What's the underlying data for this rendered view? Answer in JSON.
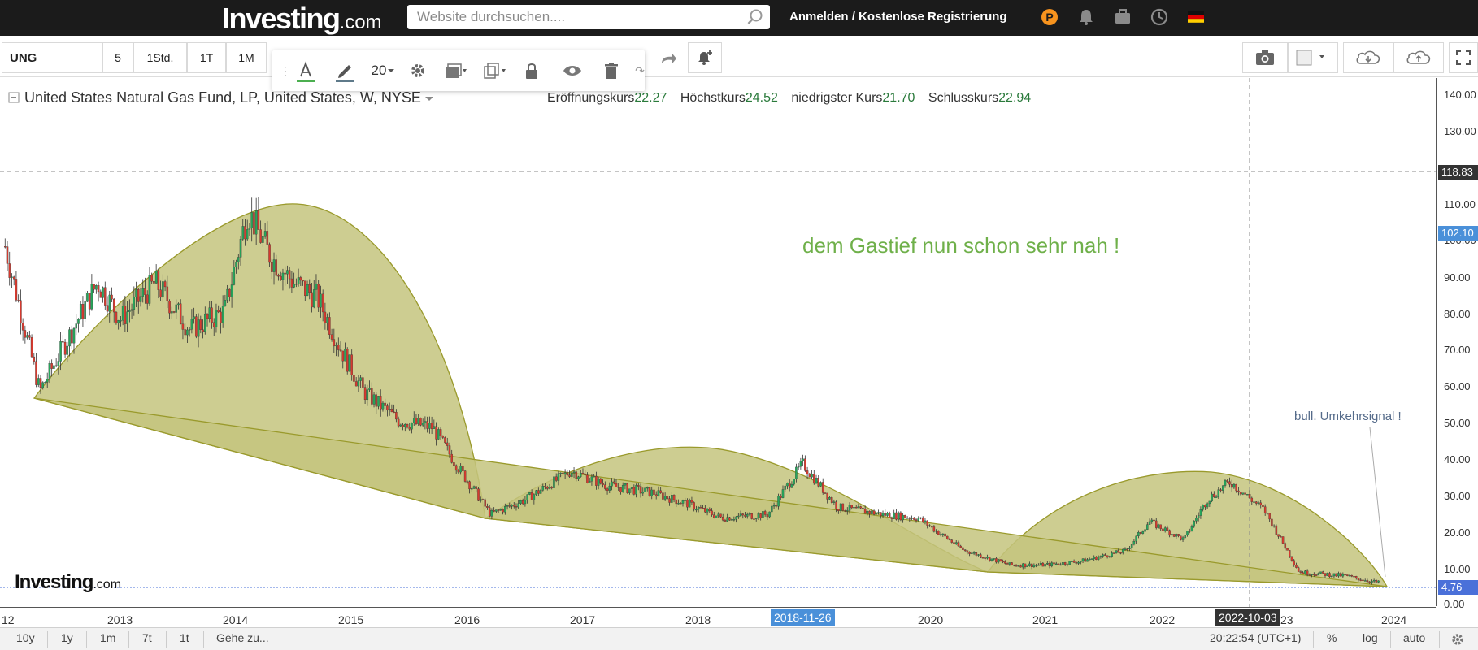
{
  "header": {
    "logo_main": "Investing",
    "logo_suffix": ".com",
    "search_placeholder": "Website durchsuchen....",
    "login": "Anmelden",
    "separator": "/",
    "register": "Kostenlose Registrierung",
    "icons": [
      "investing-pro-icon",
      "bell-icon",
      "briefcase-icon",
      "clock-icon",
      "german-flag-icon"
    ]
  },
  "toolbar": {
    "symbol": "UNG",
    "intervals": [
      "5",
      "1Std.",
      "1T",
      "1M"
    ],
    "right_icons": [
      "camera-icon",
      "layout-icon",
      "cloud-download-icon",
      "cloud-upload-icon",
      "fullscreen-icon"
    ]
  },
  "drawing_toolbar": {
    "font_size": "20",
    "tools": [
      "text-color-icon",
      "pencil-color-icon",
      "font-size-select",
      "settings-icon",
      "fill-icon",
      "clone-icon",
      "lock-icon",
      "visibility-icon",
      "trash-icon"
    ]
  },
  "legend": {
    "title": "United States Natural Gas Fund, LP, United States, W, NYSE",
    "open_label": "Eröffnungskurs",
    "open_value": "22.27",
    "high_label": "Höchstkurs",
    "high_value": "24.52",
    "low_label": "niedrigster Kurs",
    "low_value": "21.70",
    "close_label": "Schlusskurs",
    "close_value": "22.94"
  },
  "annotations": {
    "main": "dem Gastief nun schon sehr nah !",
    "signal": "bull. Umkehrsignal !"
  },
  "watermark": {
    "main": "Investing",
    "suffix": ".com"
  },
  "y_axis": {
    "labels": [
      "140.00",
      "130.00",
      "110.00",
      "100.00",
      "90.00",
      "80.00",
      "70.00",
      "60.00",
      "50.00",
      "40.00",
      "30.00",
      "20.00",
      "10.00",
      "0.00"
    ],
    "crosshair_value": "118.83",
    "tag_value": "102.10",
    "last_price": "4.76"
  },
  "x_axis": {
    "labels": [
      "12",
      "2013",
      "2014",
      "2015",
      "2016",
      "2017",
      "2018",
      "2020",
      "2021",
      "2022",
      "23",
      "2024"
    ],
    "highlight_date": "2018-11-26",
    "crosshair_date": "2022-10-03"
  },
  "bottom_bar": {
    "ranges": [
      "10y",
      "1y",
      "1m",
      "7t",
      "1t"
    ],
    "goto": "Gehe zu...",
    "time": "20:22:54 (UTC+1)",
    "percent": "%",
    "log": "log",
    "auto": "auto"
  },
  "colors": {
    "up": "#26a65b",
    "down": "#d63a2f",
    "fill": "#c4c47e",
    "accent": "#4a90d9"
  },
  "chart_data": {
    "type": "line",
    "title": "United States Natural Gas Fund, LP, United States, W, NYSE",
    "x": [
      2012.0,
      2012.3,
      2012.8,
      2013.0,
      2013.3,
      2013.6,
      2013.9,
      2014.1,
      2014.3,
      2014.5,
      2014.7,
      2014.9,
      2015.1,
      2015.4,
      2015.7,
      2015.9,
      2016.2,
      2016.5,
      2016.9,
      2017.2,
      2017.6,
      2017.9,
      2018.2,
      2018.6,
      2018.9,
      2019.2,
      2019.6,
      2019.9,
      2020.3,
      2020.7,
      2021.0,
      2021.3,
      2021.7,
      2021.9,
      2022.2,
      2022.4,
      2022.6,
      2022.9,
      2023.2,
      2023.6,
      2023.9
    ],
    "series": [
      {
        "values": [
          98,
          58,
          88,
          78,
          88,
          75,
          80,
          108,
          95,
          88,
          84,
          70,
          58,
          50,
          48,
          38,
          24,
          28,
          36,
          32,
          30,
          27,
          23,
          24,
          38,
          26,
          24,
          23,
          14,
          10,
          10,
          11,
          14,
          22,
          17,
          28,
          33,
          25,
          8,
          7,
          5
        ]
      }
    ],
    "ylim": [
      0,
      145
    ],
    "xlim": [
      2011.95,
      2024.3
    ]
  }
}
